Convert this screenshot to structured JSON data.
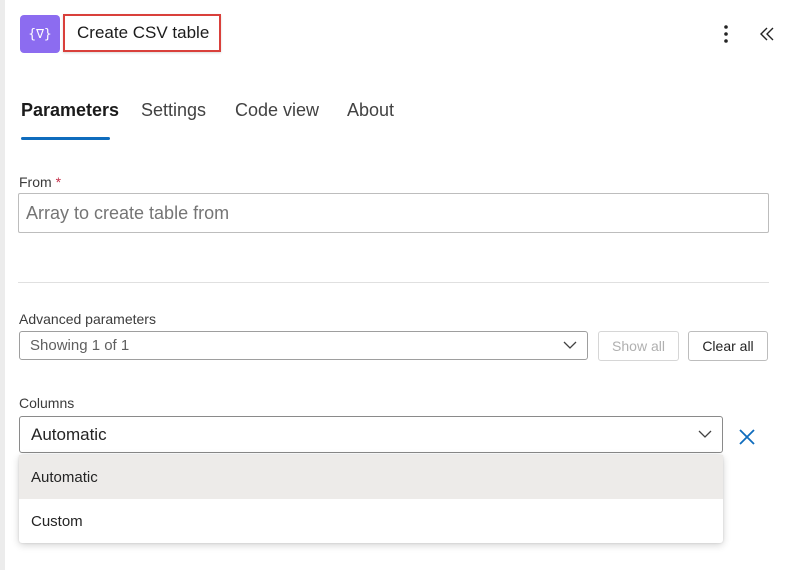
{
  "header": {
    "title": "Create CSV table",
    "app_icon_glyph": "{∇}",
    "app_icon_color": "#8c6cf0",
    "more_icon": "more-vertical-icon",
    "collapse_icon": "double-chevron-left-icon"
  },
  "tabs": [
    {
      "label": "Parameters",
      "active": true
    },
    {
      "label": "Settings",
      "active": false
    },
    {
      "label": "Code view",
      "active": false
    },
    {
      "label": "About",
      "active": false
    }
  ],
  "from": {
    "label": "From",
    "required_marker": "*",
    "placeholder": "Array to create table from"
  },
  "advanced": {
    "label": "Advanced parameters",
    "value": "Showing 1 of 1",
    "show_all_label": "Show all",
    "clear_all_label": "Clear all"
  },
  "columns": {
    "label": "Columns",
    "value": "Automatic",
    "remove_icon": "close-icon",
    "options": [
      {
        "label": "Automatic",
        "selected": true
      },
      {
        "label": "Custom",
        "selected": false
      }
    ]
  },
  "colors": {
    "accent": "#0f6cbd",
    "highlight_border": "#d9403b",
    "required": "#c4314b"
  }
}
